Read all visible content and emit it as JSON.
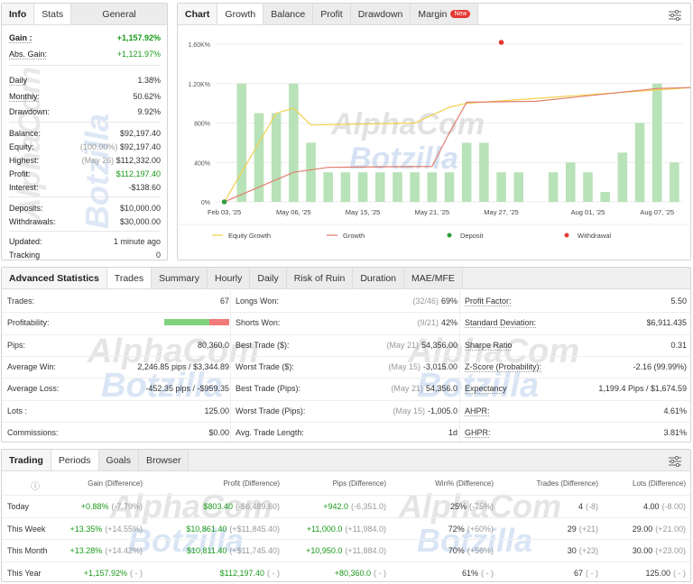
{
  "info": {
    "tabs": [
      "Info",
      "Stats",
      "General"
    ],
    "gain_label": "Gain :",
    "gain_value": "+1,157.92%",
    "absgain_label": "Abs. Gain:",
    "absgain_value": "+1,121.97%",
    "daily_label": "Daily",
    "daily_value": "1.38%",
    "monthly_label": "Monthly:",
    "monthly_value": "50.62%",
    "drawdown_label": "Drawdown:",
    "drawdown_value": "9.92%",
    "balance_label": "Balance:",
    "balance_value": "$92,197.40",
    "equity_label": "Equity:",
    "equity_pct": "(100.00%)",
    "equity_value": "$92,197.40",
    "highest_label": "Highest:",
    "highest_date": "(May 26)",
    "highest_value": "$112,332.00",
    "profit_label": "Profit:",
    "profit_value": "$112,197.40",
    "interest_label": "Interest:",
    "interest_value": "-$138.60",
    "deposits_label": "Deposits:",
    "deposits_value": "$10,000.00",
    "withdrawals_label": "Withdrawals:",
    "withdrawals_value": "$30,000.00",
    "updated_label": "Updated:",
    "updated_value": "1 minute ago",
    "tracking_label": "Tracking",
    "tracking_value": "0"
  },
  "chart_panel": {
    "tabs": [
      "Chart",
      "Growth",
      "Balance",
      "Profit",
      "Drawdown",
      "Margin"
    ],
    "badge": "New",
    "legend": [
      "Equity Growth",
      "Growth",
      "Deposit",
      "Withdrawal"
    ]
  },
  "chart_data": {
    "type": "bar",
    "y_ticks": [
      "0%",
      "400%",
      "800%",
      "1.20K%",
      "1.60K%"
    ],
    "x_ticks": [
      "Feb 03, '25",
      "May 06, '25",
      "May 15, '25",
      "May 21, '25",
      "May 27, '25",
      "Aug 01, '25",
      "Aug 07, '25"
    ],
    "ylim": [
      0,
      1600
    ],
    "bars": [
      0,
      1200,
      900,
      900,
      1200,
      600,
      300,
      300,
      300,
      300,
      300,
      300,
      300,
      300,
      600,
      600,
      300,
      300,
      0,
      300,
      400,
      300,
      100,
      500,
      800,
      1200,
      400
    ],
    "equity_growth": [
      [
        0,
        0
      ],
      [
        1,
        300
      ],
      [
        2,
        600
      ],
      [
        3,
        900
      ],
      [
        4,
        950
      ],
      [
        5,
        780
      ],
      [
        8,
        790
      ],
      [
        11,
        800
      ],
      [
        13,
        960
      ],
      [
        14,
        1000
      ],
      [
        27,
        1160
      ]
    ],
    "growth": [
      [
        0,
        0
      ],
      [
        4,
        300
      ],
      [
        6,
        350
      ],
      [
        12,
        360
      ],
      [
        13,
        700
      ],
      [
        14,
        1010
      ],
      [
        18,
        1020
      ],
      [
        25,
        1150
      ],
      [
        27,
        1160
      ]
    ],
    "deposit": [
      [
        0,
        0
      ]
    ],
    "withdrawal": [
      [
        16,
        1600
      ]
    ],
    "colors": {
      "bar": "#b8e2b8",
      "equity": "#f2d14e",
      "growth": "#e07f6f",
      "deposit": "#2e9e3a",
      "withdrawal": "#e53935"
    }
  },
  "advanced": {
    "tabs": [
      "Advanced Statistics",
      "Trades",
      "Summary",
      "Hourly",
      "Daily",
      "Risk of Ruin",
      "Duration",
      "MAE/MFE"
    ],
    "col1": [
      {
        "label": "Trades:",
        "value": "67"
      },
      {
        "label": "Profitability:",
        "value": ""
      },
      {
        "label": "Pips:",
        "value": "80,360.0"
      },
      {
        "label": "Average Win:",
        "value": "2,246.85 pips / $3,344.89"
      },
      {
        "label": "Average Loss:",
        "value": "-452.35 pips / -$959.35"
      },
      {
        "label": "Lots :",
        "value": "125.00"
      },
      {
        "label": "Commissions:",
        "value": "$0.00"
      }
    ],
    "profitability_win": 0.69,
    "col2": [
      {
        "label": "Longs Won:",
        "pre": "(32/46)",
        "value": "69%"
      },
      {
        "label": "Shorts Won:",
        "pre": "(9/21)",
        "value": "42%"
      },
      {
        "label": "Best Trade ($):",
        "pre": "(May 21)",
        "value": "54,356.00"
      },
      {
        "label": "Worst Trade ($):",
        "pre": "(May 15)",
        "value": "-3,015.00"
      },
      {
        "label": "Best Trade (Pips):",
        "pre": "(May 21)",
        "value": "54,356.0"
      },
      {
        "label": "Worst Trade (Pips):",
        "pre": "(May 15)",
        "value": "-1,005.0"
      },
      {
        "label": "Avg. Trade Length:",
        "pre": "",
        "value": "1d"
      }
    ],
    "col3": [
      {
        "label": "Profit Factor:",
        "value": "5.50"
      },
      {
        "label": "Standard Deviation:",
        "value": "$6,911.435"
      },
      {
        "label": "Sharpe Ratio",
        "value": "0.31"
      },
      {
        "label": "Z-Score (Probability):",
        "value": "-2.16 (99.99%)"
      },
      {
        "label": "Expectancy",
        "value": "1,199.4 Pips / $1,674.59"
      },
      {
        "label": "AHPR:",
        "value": "4.61%"
      },
      {
        "label": "GHPR:",
        "value": "3.81%"
      }
    ]
  },
  "trading": {
    "tabs": [
      "Trading",
      "Periods",
      "Goals",
      "Browser"
    ],
    "headers": [
      "Gain (Difference)",
      "Profit (Difference)",
      "Pips (Difference)",
      "Win% (Difference)",
      "Trades (Difference)",
      "Lots (Difference)"
    ],
    "info_icon": "ⓘ",
    "rows": [
      {
        "name": "Today",
        "gain": "+0.88%",
        "gain_d": "(-7.79%)",
        "profit": "$803.40",
        "profit_d": "(-$6,489.60)",
        "pips": "+942.0",
        "pips_d": "(-6,351.0)",
        "win": "25%",
        "win_d": "(-75%)",
        "trades": "4",
        "trades_d": "(-8)",
        "lots": "4.00",
        "lots_d": "(-8.00)"
      },
      {
        "name": "This Week",
        "gain": "+13.35%",
        "gain_d": "(+14.55%)",
        "profit": "$10,861.40",
        "profit_d": "(+$11,845.40)",
        "pips": "+11,000.0",
        "pips_d": "(+11,984.0)",
        "win": "72%",
        "win_d": "(+60%)",
        "trades": "29",
        "trades_d": "(+21)",
        "lots": "29.00",
        "lots_d": "(+21.00)"
      },
      {
        "name": "This Month",
        "gain": "+13.28%",
        "gain_d": "(+14.42%)",
        "profit": "$10,811.40",
        "profit_d": "(+$11,745.40)",
        "pips": "+10,950.0",
        "pips_d": "(+11,884.0)",
        "win": "70%",
        "win_d": "(+56%)",
        "trades": "30",
        "trades_d": "(+23)",
        "lots": "30.00",
        "lots_d": "(+23.00)"
      },
      {
        "name": "This Year",
        "gain": "+1,157.92%",
        "gain_d": "( - )",
        "profit": "$112,197.40",
        "profit_d": "( - )",
        "pips": "+80,360.0",
        "pips_d": "( - )",
        "win": "61%",
        "win_d": "( - )",
        "trades": "67",
        "trades_d": "( - )",
        "lots": "125.00",
        "lots_d": "( - )"
      }
    ]
  },
  "watermark": {
    "line1": "AlphaCom",
    "line2": "Botzilla"
  }
}
